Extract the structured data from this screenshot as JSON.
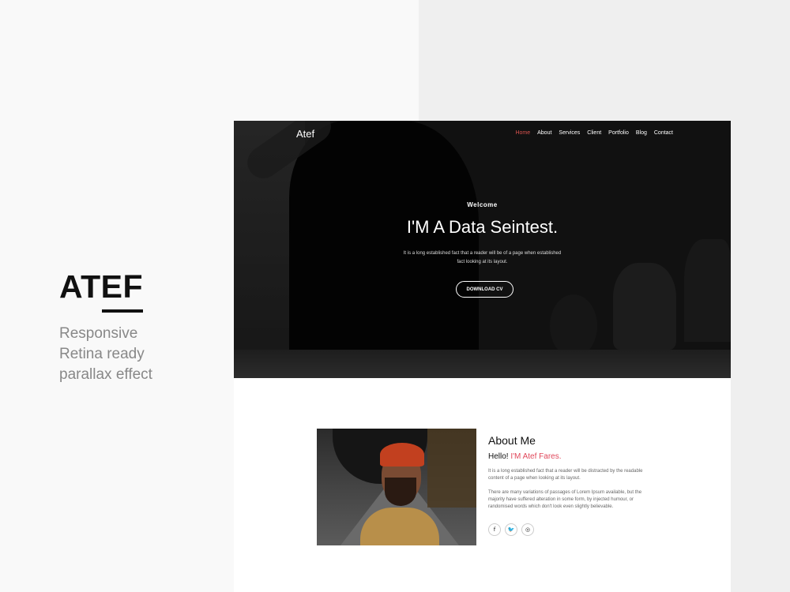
{
  "promo": {
    "brand": "ATEF",
    "features": [
      "Responsive",
      "Retina ready",
      "parallax effect"
    ]
  },
  "site": {
    "logo": "Atef",
    "nav": [
      {
        "label": "Home",
        "active": true
      },
      {
        "label": "About",
        "active": false
      },
      {
        "label": "Services",
        "active": false
      },
      {
        "label": "Client",
        "active": false
      },
      {
        "label": "Portfolio",
        "active": false
      },
      {
        "label": "Blog",
        "active": false
      },
      {
        "label": "Contact",
        "active": false
      }
    ],
    "hero": {
      "welcome": "Welcome",
      "headline": "I'M A Data Seintest.",
      "text": "It is a long established fact that a reader will be of a page when established fact looking at its layout.",
      "cta": "DOWNLOAD CV"
    },
    "about": {
      "title": "About Me",
      "hello": "Hello!",
      "name": "I'M Atef Fares.",
      "p1": "It is a long established fact that a reader will be distracted by the readable content of a page when looking at its layout.",
      "p2": "There are many variations of passages of Lorem Ipsum available, but the majority have suffered alteration in some form, by injected humour, or randomised words which don't look even slightly believable.",
      "socials": [
        {
          "icon": "facebook-icon",
          "glyph": "f"
        },
        {
          "icon": "twitter-icon",
          "glyph": "🐦"
        },
        {
          "icon": "instagram-icon",
          "glyph": "◎"
        }
      ]
    }
  },
  "colors": {
    "accent": "#e0475a",
    "nav_active": "#d9534f",
    "dark": "#111111"
  }
}
